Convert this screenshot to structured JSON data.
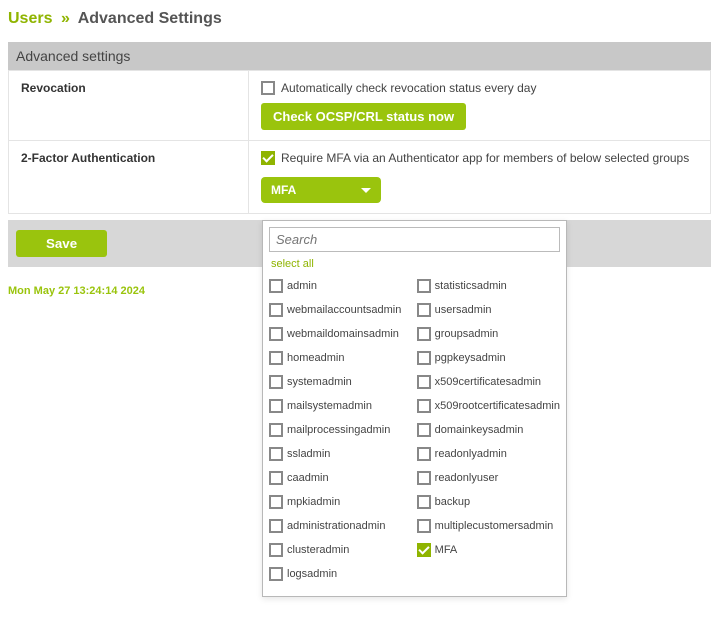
{
  "breadcrumb": {
    "parent": "Users",
    "sep": "»",
    "current": "Advanced Settings"
  },
  "panel_title": "Advanced settings",
  "rows": {
    "revocation": {
      "label": "Revocation",
      "checkbox_label": "Automatically check revocation status every day",
      "button": "Check OCSP/CRL status now"
    },
    "mfa": {
      "label": "2-Factor Authentication",
      "checkbox_label": "Require MFA via an Authenticator app for members of below selected groups",
      "dropdown_value": "MFA"
    }
  },
  "save": "Save",
  "timestamp": "Mon May 27 13:24:14 2024",
  "popup": {
    "search_placeholder": "Search",
    "select_all": "select all",
    "left": [
      {
        "label": "admin",
        "checked": false
      },
      {
        "label": "webmailaccountsadmin",
        "checked": false
      },
      {
        "label": "webmaildomainsadmin",
        "checked": false
      },
      {
        "label": "homeadmin",
        "checked": false
      },
      {
        "label": "systemadmin",
        "checked": false
      },
      {
        "label": "mailsystemadmin",
        "checked": false
      },
      {
        "label": "mailprocessingadmin",
        "checked": false
      },
      {
        "label": "ssladmin",
        "checked": false
      },
      {
        "label": "caadmin",
        "checked": false
      },
      {
        "label": "mpkiadmin",
        "checked": false
      },
      {
        "label": "administrationadmin",
        "checked": false
      },
      {
        "label": "clusteradmin",
        "checked": false
      },
      {
        "label": "logsadmin",
        "checked": false
      }
    ],
    "right": [
      {
        "label": "statisticsadmin",
        "checked": false
      },
      {
        "label": "usersadmin",
        "checked": false
      },
      {
        "label": "groupsadmin",
        "checked": false
      },
      {
        "label": "pgpkeysadmin",
        "checked": false
      },
      {
        "label": "x509certificatesadmin",
        "checked": false
      },
      {
        "label": "x509rootcertificatesadmin",
        "checked": false
      },
      {
        "label": "domainkeysadmin",
        "checked": false
      },
      {
        "label": "readonlyadmin",
        "checked": false
      },
      {
        "label": "readonlyuser",
        "checked": false
      },
      {
        "label": "backup",
        "checked": false
      },
      {
        "label": "multiplecustomersadmin",
        "checked": false
      },
      {
        "label": "MFA",
        "checked": true
      }
    ]
  }
}
